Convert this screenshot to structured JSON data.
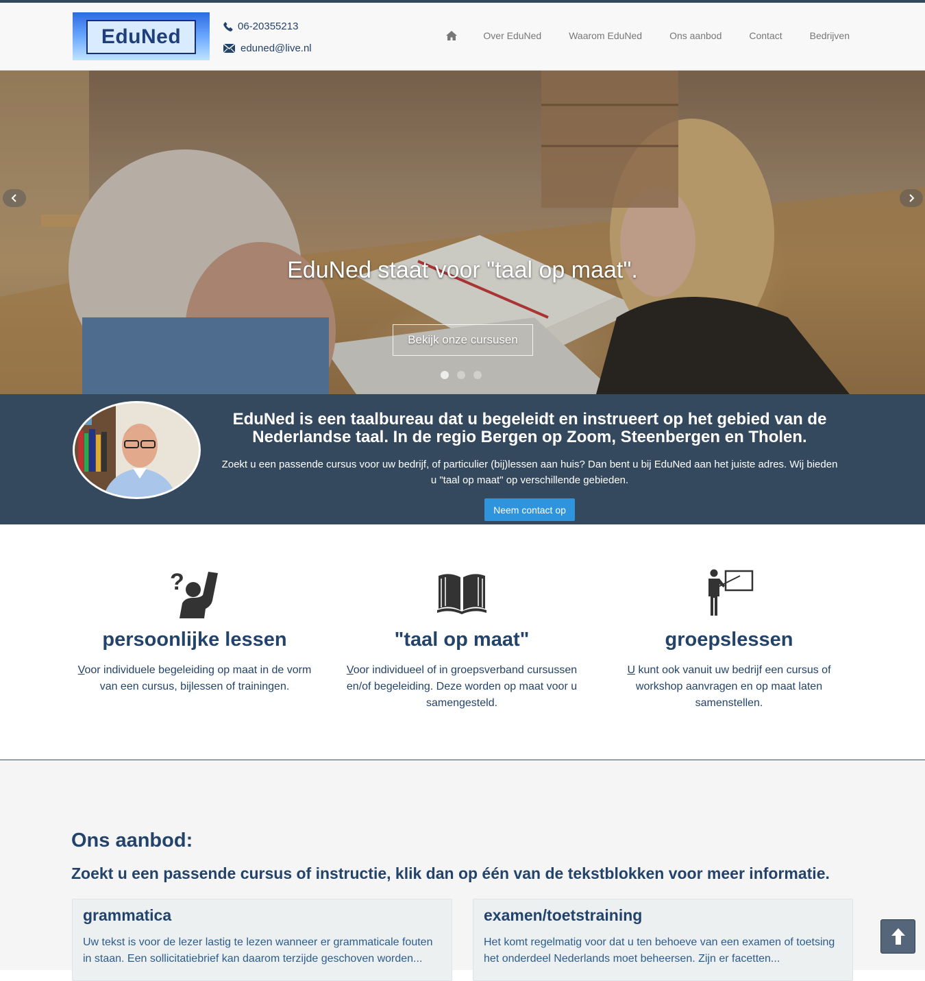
{
  "header": {
    "logo_text": "EduNed",
    "phone": "06-20355213",
    "email": "eduned@live.nl",
    "nav": {
      "home_icon": "home-icon",
      "items": [
        "Over EduNed",
        "Waarom EduNed",
        "Ons aanbod",
        "Contact",
        "Bedrijven"
      ]
    }
  },
  "hero": {
    "caption": "EduNed staat voor \"taal op maat\".",
    "button": "Bekijk onze cursusen",
    "prev_icon": "chevron-left-icon",
    "next_icon": "chevron-right-icon",
    "slides_count": 3,
    "active_slide": 1
  },
  "intro": {
    "title": "EduNed is een taalbureau dat u begeleidt en instrueert op het gebied van de Nederlandse taal. In de regio Bergen op Zoom, Steenbergen en Tholen.",
    "text": "Zoekt u een passende cursus voor uw bedrijf, of particulier (bij)lessen aan huis? Dan bent u bij EduNed aan het juiste adres. Wij bieden u \"taal op maat\" op verschillende gebieden.",
    "button": "Neem contact op"
  },
  "features": [
    {
      "icon": "question-person-icon",
      "title": "persoonlijke lessen",
      "first_letter": "V",
      "text": "oor individuele begeleiding op maat in de vorm van een cursus, bijlessen of trainingen."
    },
    {
      "icon": "open-book-icon",
      "title": "\"taal op maat\"",
      "first_letter": "V",
      "text": "oor individueel of in groepsverband cursussen en/of begeleiding. Deze worden op maat voor u samengesteld."
    },
    {
      "icon": "teacher-board-icon",
      "title": "groepslessen",
      "first_letter": "U",
      "text": " kunt ook vanuit uw bedrijf een cursus of workshop aanvragen en op maat laten samenstellen."
    }
  ],
  "offer": {
    "title": "Ons aanbod:",
    "subtitle": "Zoekt u een passende cursus of instructie, klik dan op één van de tekstblokken voor meer informatie.",
    "cards": [
      {
        "title": "grammatica",
        "text": "Uw tekst is voor de lezer lastig te lezen wanneer er grammaticale fouten in staan. Een sollicitatiebrief kan daarom terzijde geschoven worden..."
      },
      {
        "title": "examen/toetstraining",
        "text": "Het komt regelmatig voor dat u ten behoeve van een examen of toetsing het onderdeel Nederlands moet beheersen. Zijn er facetten..."
      }
    ]
  },
  "back_to_top_icon": "arrow-up-icon",
  "colors": {
    "navy": "#34495e",
    "heading": "#23436b",
    "button_blue": "#2e94dd"
  }
}
